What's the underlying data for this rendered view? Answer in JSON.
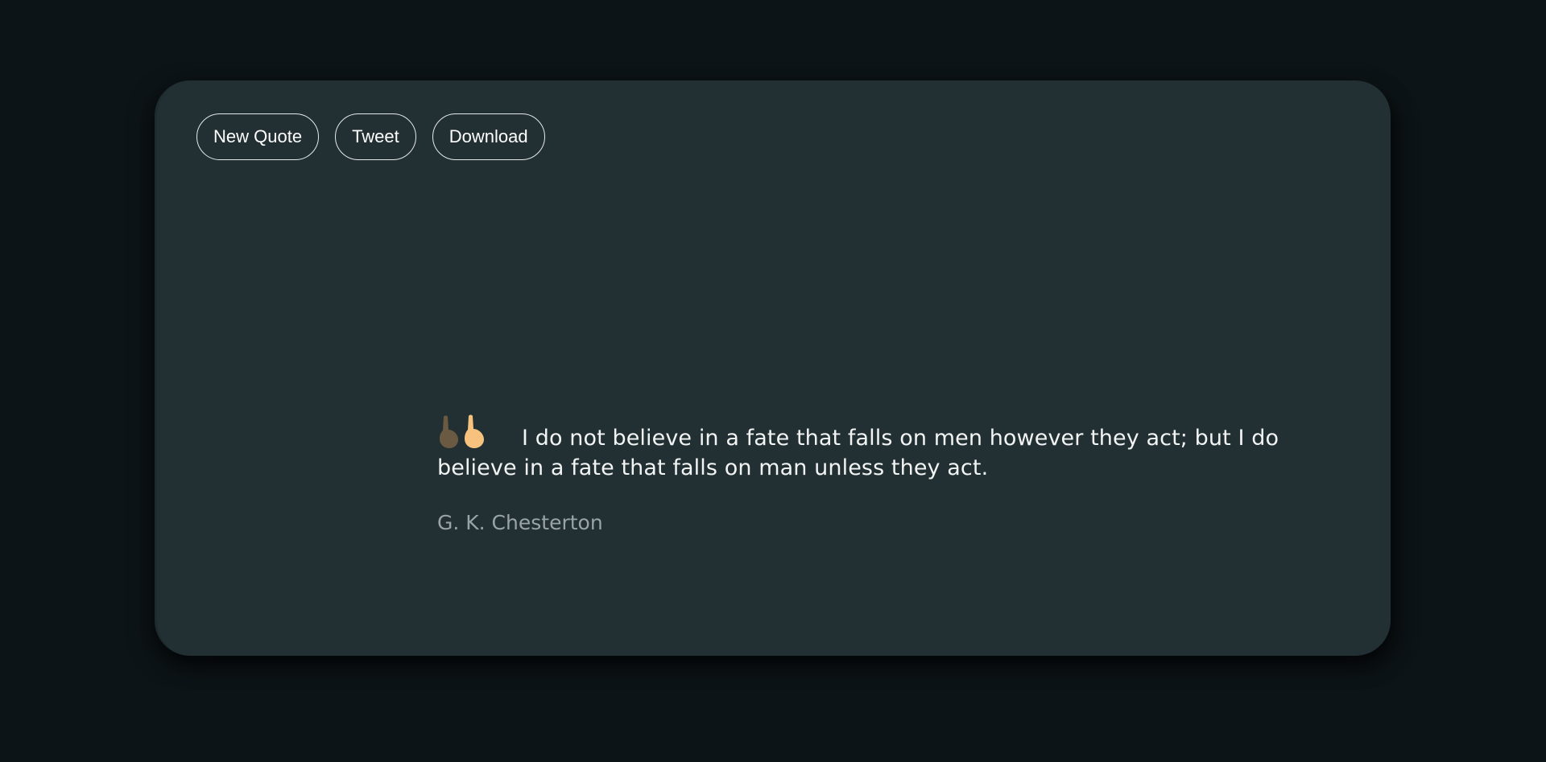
{
  "toolbar": {
    "new_quote_label": "New Quote",
    "tweet_label": "Tweet",
    "download_label": "Download"
  },
  "quote": {
    "icon": "quote-fingers-icon",
    "text": "I do not believe in a fate that falls on men however they act; but I do believe in a fate that falls on man unless they act.",
    "author": "G. K. Chesterton"
  },
  "colors": {
    "background": "#0d1417",
    "card": "#223033",
    "quote_text": "#f2f4f4",
    "author_text": "#9aa3a6",
    "icon_dark": "#6b5a42",
    "icon_light": "#f6c27e"
  }
}
